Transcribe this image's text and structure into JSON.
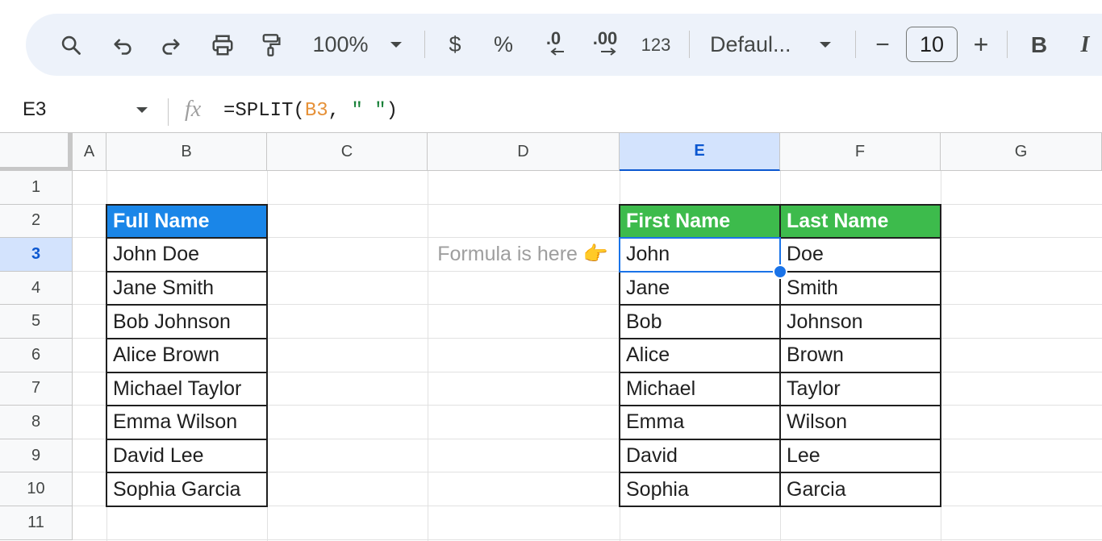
{
  "toolbar": {
    "zoom": "100%",
    "currency": "$",
    "percent": "%",
    "decrease_decimal": ".0",
    "increase_decimal": ".00",
    "number_format": "123",
    "font": "Defaul...",
    "font_size": "10",
    "minus": "−",
    "plus": "+",
    "bold": "B",
    "italic": "I"
  },
  "formula_bar": {
    "name_box": "E3",
    "fx": "fx",
    "formula_prefix": "=SPLIT(",
    "formula_ref": "B3",
    "formula_sep": ", ",
    "formula_str": "\" \"",
    "formula_suffix": ")"
  },
  "columns": [
    "A",
    "B",
    "C",
    "D",
    "E",
    "F",
    "G"
  ],
  "rows": [
    "1",
    "2",
    "3",
    "4",
    "5",
    "6",
    "7",
    "8",
    "9",
    "10",
    "11"
  ],
  "selected": {
    "column": "E",
    "row": "3"
  },
  "table_full": {
    "header": "Full Name",
    "values": [
      "John Doe",
      "Jane Smith",
      "Bob Johnson",
      "Alice Brown",
      "Michael Taylor",
      "Emma Wilson",
      "David Lee",
      "Sophia Garcia"
    ]
  },
  "table_split": {
    "first_header": "First Name",
    "last_header": "Last Name",
    "first": [
      "John",
      "Jane",
      "Bob",
      "Alice",
      "Michael",
      "Emma",
      "David",
      "Sophia"
    ],
    "last": [
      "Doe",
      "Smith",
      "Johnson",
      "Brown",
      "Taylor",
      "Wilson",
      "Lee",
      "Garcia"
    ]
  },
  "note": "Formula is here 👉",
  "colors": {
    "header_blue": "#1a86e8",
    "header_green": "#3dbb4c",
    "selection": "#1a73e8"
  }
}
